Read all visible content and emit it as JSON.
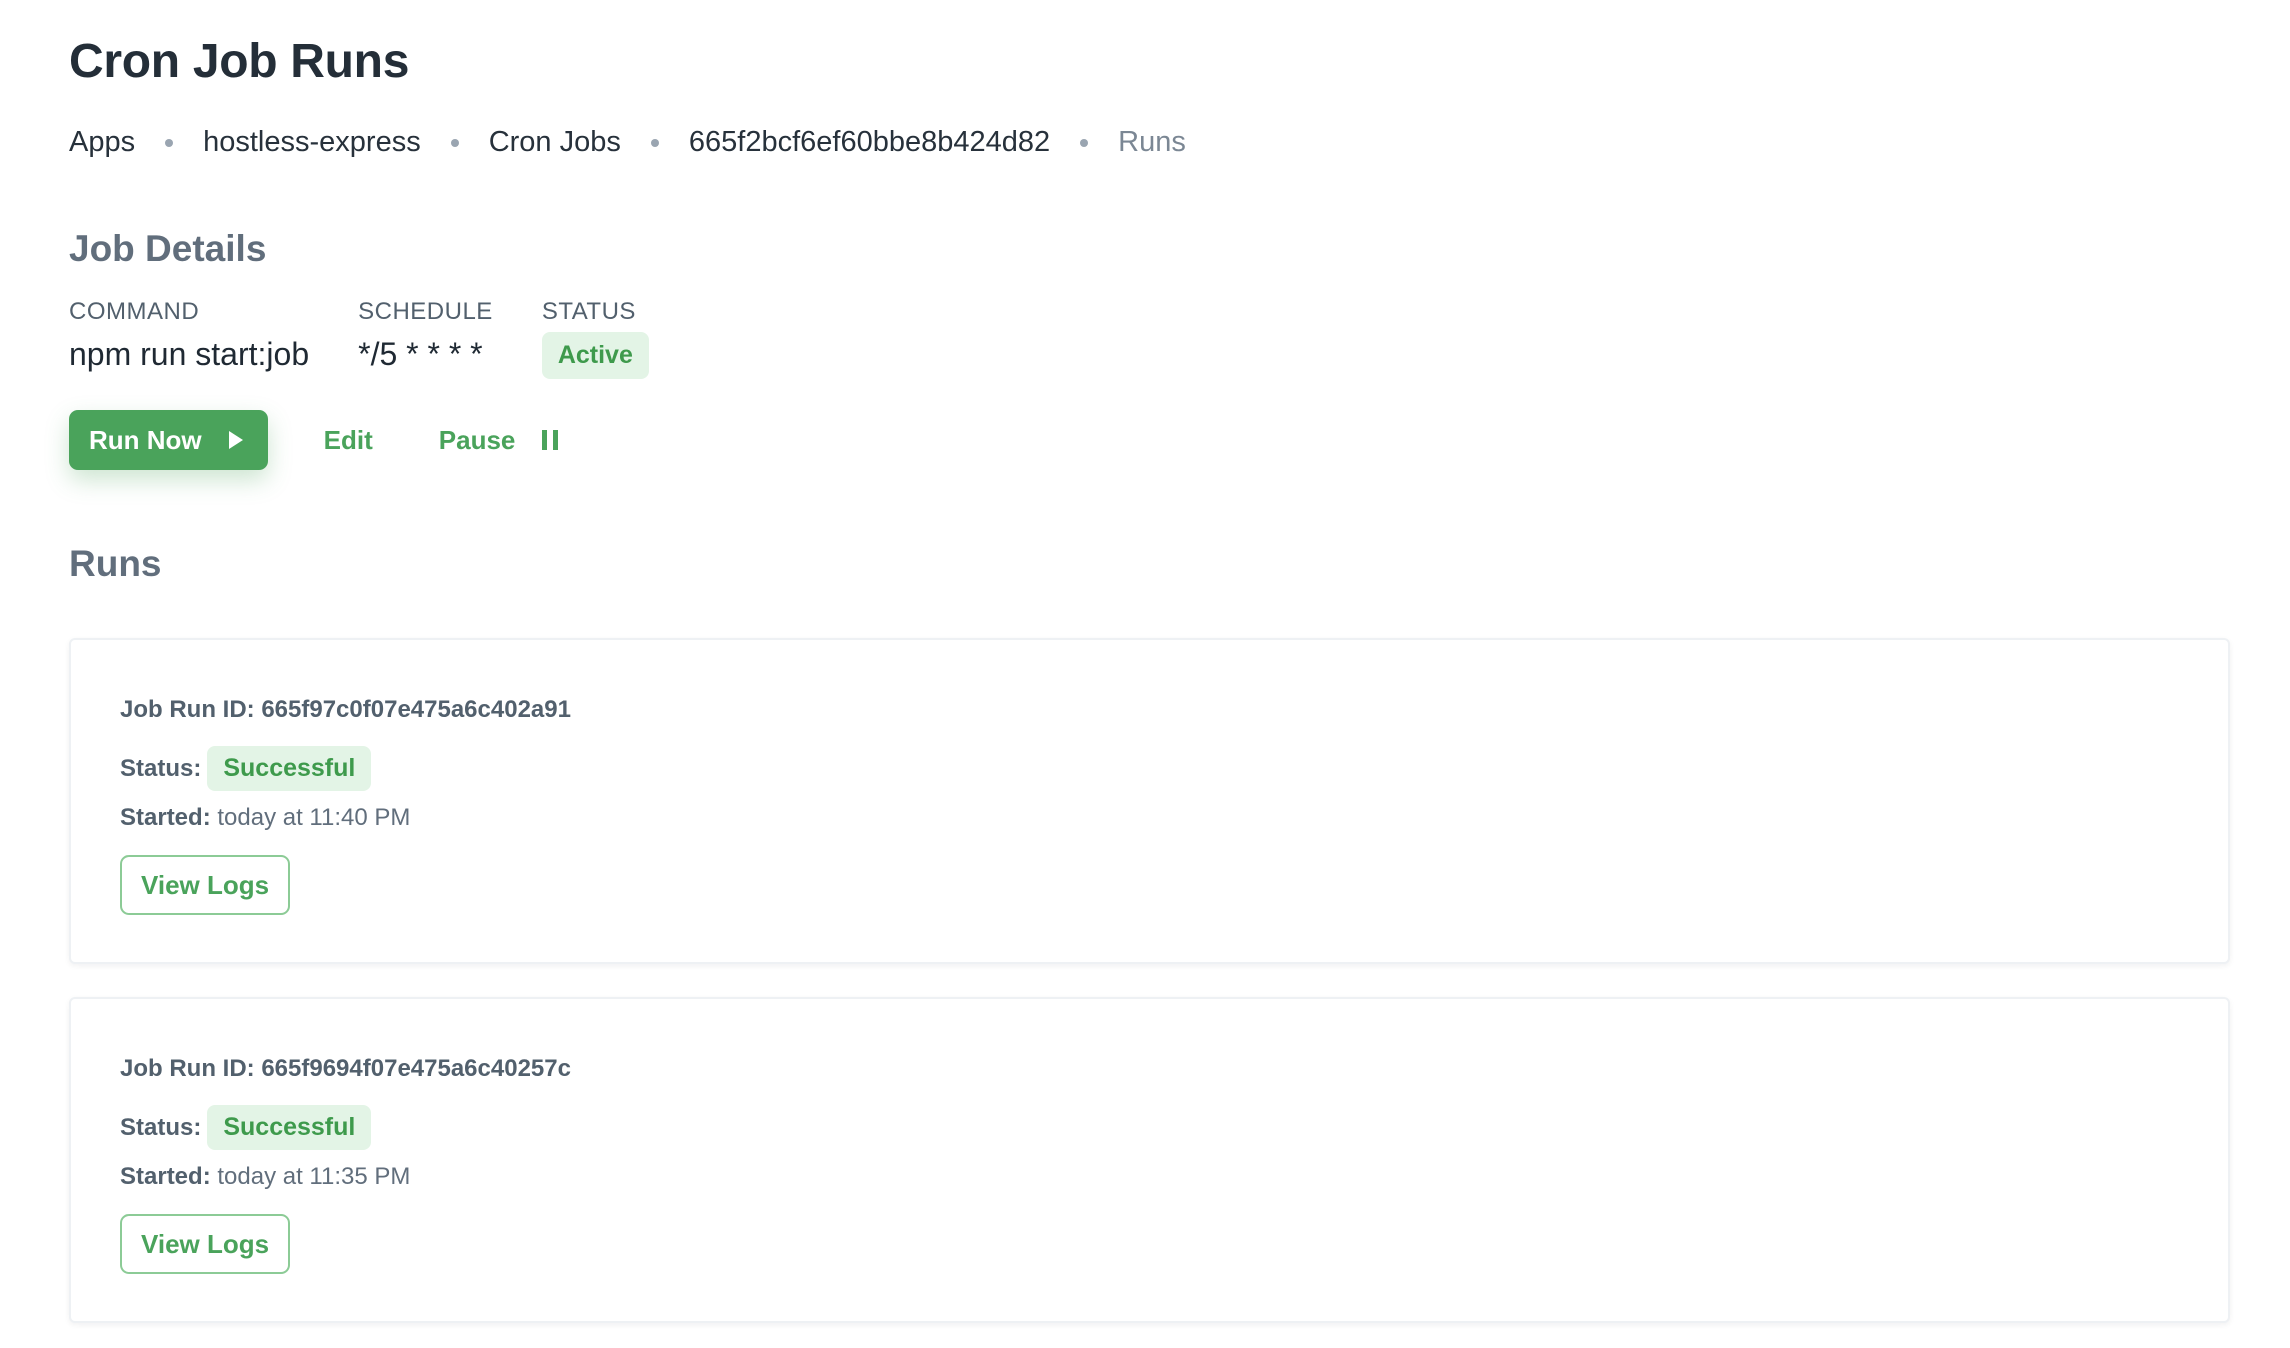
{
  "page": {
    "title": "Cron Job Runs"
  },
  "breadcrumb": [
    {
      "label": "Apps"
    },
    {
      "label": "hostless-express"
    },
    {
      "label": "Cron Jobs"
    },
    {
      "label": "665f2bcf6ef60bbe8b424d82"
    },
    {
      "label": "Runs",
      "current": true
    }
  ],
  "job_details": {
    "heading": "Job Details",
    "command": {
      "label": "COMMAND",
      "value": "npm run start:job"
    },
    "schedule": {
      "label": "SCHEDULE",
      "value": "*/5 * * * *"
    },
    "status": {
      "label": "STATUS",
      "value": "Active",
      "color": "#3e9a4c"
    }
  },
  "actions": {
    "run_now": {
      "label": "Run Now",
      "icon": "play-icon"
    },
    "edit": {
      "label": "Edit"
    },
    "pause": {
      "label": "Pause",
      "icon": "pause-icon"
    }
  },
  "runs": {
    "heading": "Runs",
    "id_label": "Job Run ID:",
    "status_label": "Status:",
    "started_label": "Started:",
    "items": [
      {
        "id": "665f97c0f07e475a6c402a91",
        "status": "Successful",
        "started": "today at 11:40 PM",
        "button": "View Logs"
      },
      {
        "id": "665f9694f07e475a6c40257c",
        "status": "Successful",
        "started": "today at 11:35 PM",
        "button": "View Logs"
      }
    ]
  },
  "colors": {
    "accent": "#4aa35b",
    "badge_bg": "#e3f4e6",
    "text": "#1f2933",
    "muted": "#52606d"
  }
}
